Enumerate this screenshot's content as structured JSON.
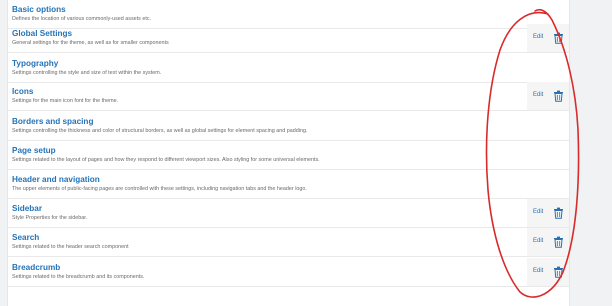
{
  "rows": [
    {
      "title": "Basic options",
      "desc": "Defines the location of various commonly-used assets etc.",
      "has_actions": false
    },
    {
      "title": "Global Settings",
      "desc": "General settings for the theme, as well as for smaller components",
      "has_actions": true
    },
    {
      "title": "Typography",
      "desc": "Settings controlling the style and size of text within the system.",
      "has_actions": false
    },
    {
      "title": "Icons",
      "desc": "Settings for the main icon font for the theme.",
      "has_actions": true
    },
    {
      "title": "Borders and spacing",
      "desc": "Settings controlling the thickness and color of structural borders, as well as global settings for element spacing and padding.",
      "has_actions": false
    },
    {
      "title": "Page setup",
      "desc": "Settings related to the layout of pages and how they respond to different viewport sizes. Also styling for some universal elements.",
      "has_actions": false
    },
    {
      "title": "Header and navigation",
      "desc": "The upper elements of public-facing pages are controlled with these settings, including navigation tabs and the header logo.",
      "has_actions": false
    },
    {
      "title": "Sidebar",
      "desc": "Style Properties for the sidebar.",
      "has_actions": true
    },
    {
      "title": "Search",
      "desc": "Settings related to the header search component",
      "has_actions": true
    },
    {
      "title": "Breadcrumb",
      "desc": "Settings related to the breadcrumb and its components.",
      "has_actions": true
    }
  ],
  "actions": {
    "edit_label": "Edit",
    "delete_icon": "trash-icon"
  },
  "colors": {
    "title": "#2473b8",
    "annotation": "#d92b2b"
  }
}
